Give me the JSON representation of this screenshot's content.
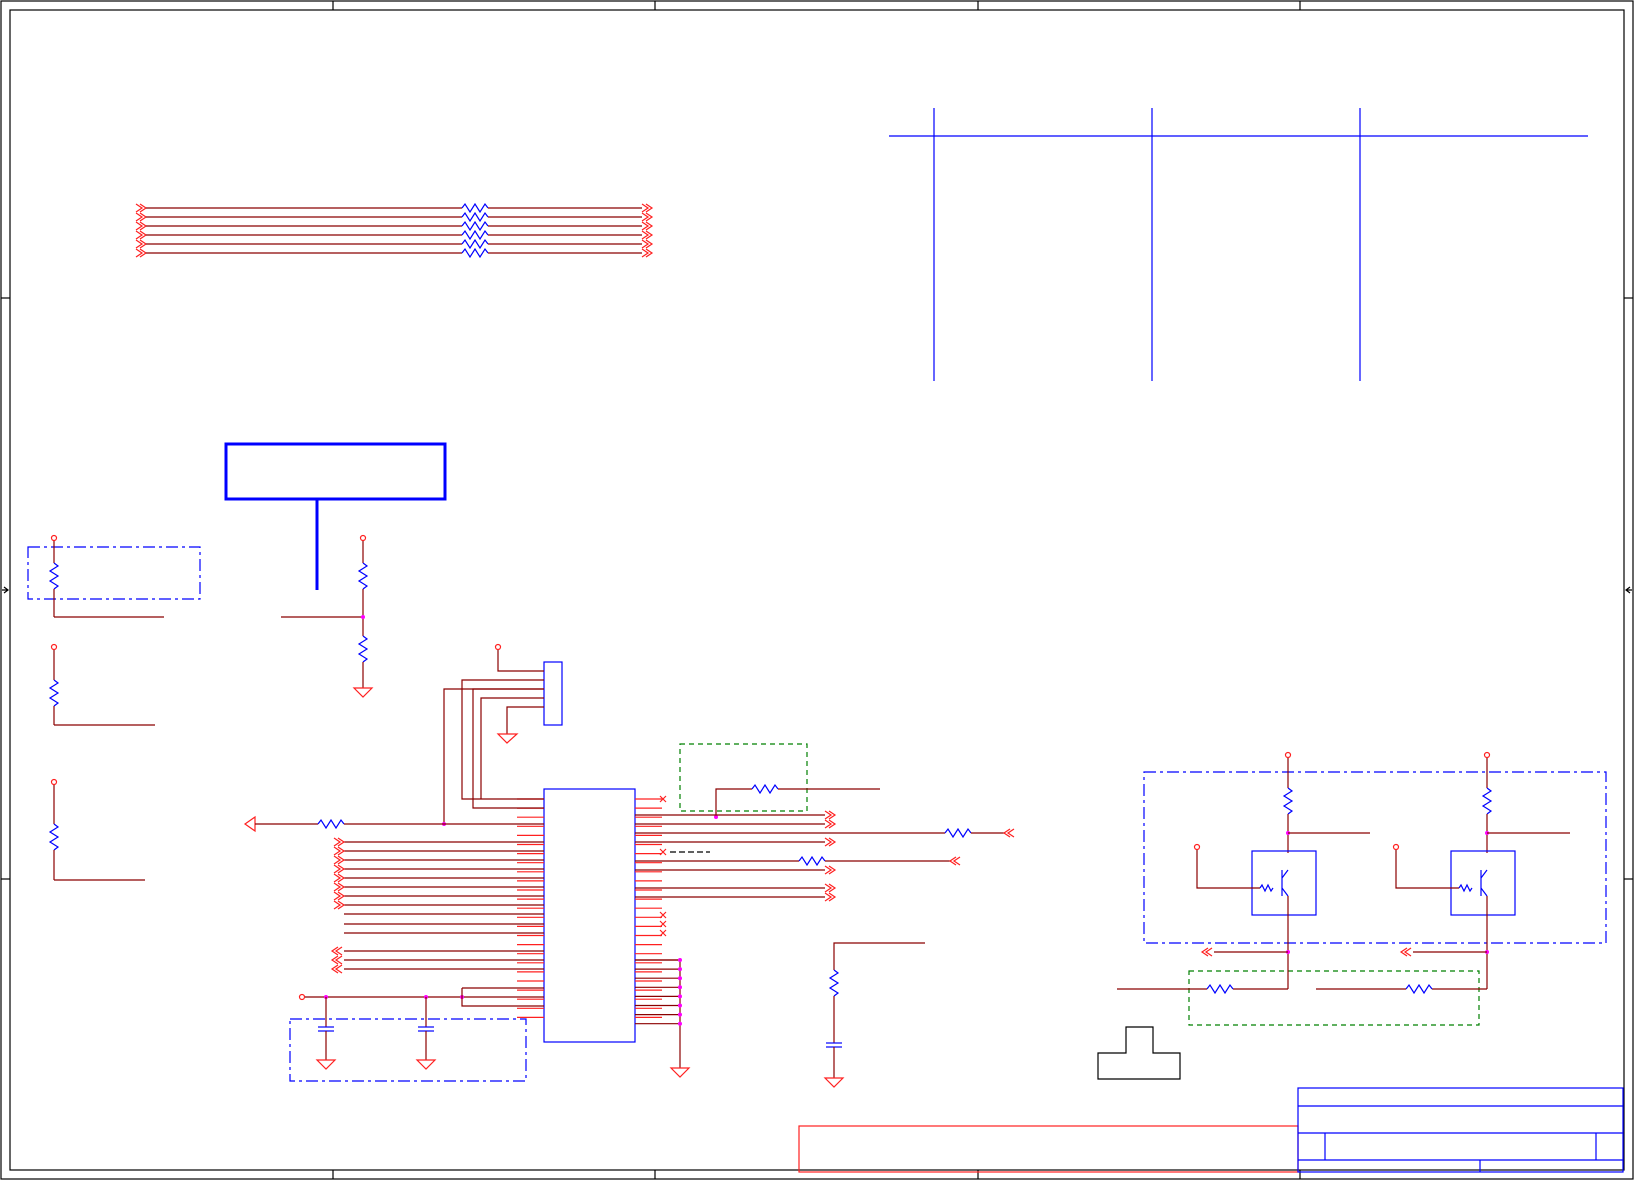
{
  "sheet": {
    "title": "",
    "border_color": "#000000",
    "wire_color": "#8b0000",
    "pin_color": "#ff2020",
    "component_color": "#0000ff",
    "junction_color": "#ff00ff",
    "group_outline_color": "#0000ff",
    "alt_group_outline_color": "#008000"
  },
  "symbols": {
    "resistor": "zigzag",
    "capacitor": "parallel-plates",
    "ground": "triangle",
    "power": "open-circle",
    "transistor": "npn-bjt",
    "off_page_connector": "chevron"
  }
}
